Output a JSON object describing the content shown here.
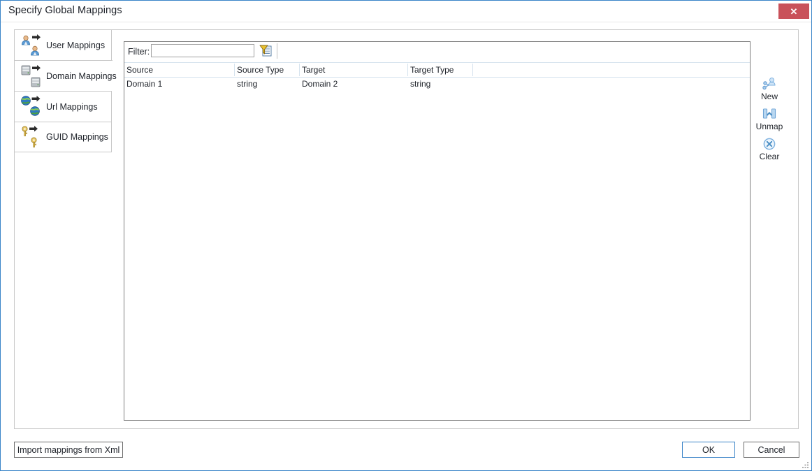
{
  "window": {
    "title": "Specify Global Mappings",
    "close_label": "✕",
    "accent_color": "#3a84c8",
    "close_color": "#c9515a"
  },
  "sidebar": {
    "selected": "Domain Mappings",
    "items": [
      {
        "label": "User Mappings",
        "icon": "user-mapping-icon",
        "selected": false
      },
      {
        "label": "Domain Mappings",
        "icon": "domain-mapping-icon",
        "selected": true
      },
      {
        "label": "Url Mappings",
        "icon": "url-mapping-icon",
        "selected": false
      },
      {
        "label": "GUID Mappings",
        "icon": "guid-mapping-icon",
        "selected": false
      }
    ]
  },
  "filter": {
    "label": "Filter:",
    "value": "",
    "placeholder": "",
    "icon": "filter-funnel-icon"
  },
  "grid": {
    "columns": [
      "Source",
      "Source Type",
      "Target",
      "Target Type"
    ],
    "rows": [
      {
        "source": "Domain 1",
        "source_type": "string",
        "target": "Domain 2",
        "target_type": "string"
      }
    ]
  },
  "actions": [
    {
      "label": "New",
      "icon": "new-mapping-icon"
    },
    {
      "label": "Unmap",
      "icon": "unmap-link-icon"
    },
    {
      "label": "Clear",
      "icon": "clear-circle-x-icon"
    }
  ],
  "footer": {
    "import_label": "Import mappings from Xml",
    "ok_label": "OK",
    "cancel_label": "Cancel"
  }
}
